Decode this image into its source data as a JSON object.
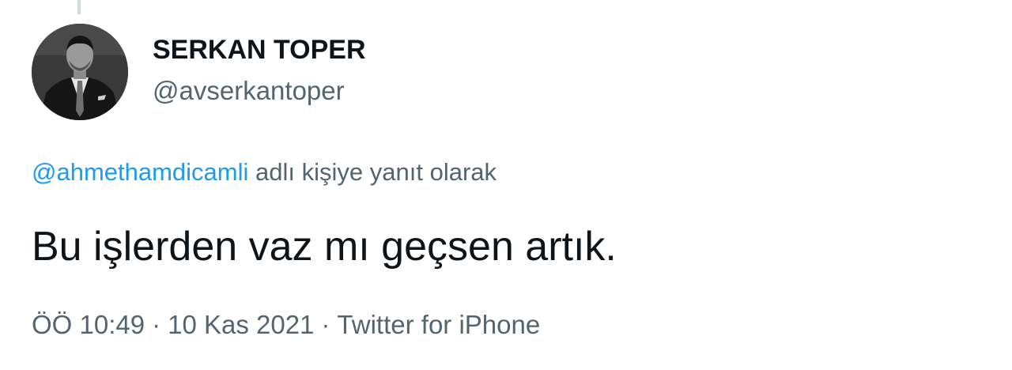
{
  "author": {
    "name": "SERKAN TOPER",
    "handle": "@avserkantoper",
    "avatar_icon": "profile-photo"
  },
  "reply": {
    "mention": "@ahmethamdicamli",
    "suffix": "adlı kişiye yanıt olarak"
  },
  "tweet": {
    "text": "Bu işlerden vaz mı geçsen artık."
  },
  "meta": {
    "time": "ÖÖ 10:49",
    "separator": "·",
    "date": "10 Kas 2021",
    "source": "Twitter for iPhone"
  },
  "colors": {
    "link": "#1d9bf0",
    "secondary_text": "#536471",
    "primary_text": "#0f1419"
  }
}
